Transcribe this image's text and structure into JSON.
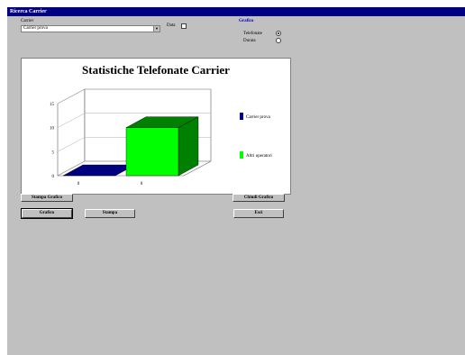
{
  "window": {
    "title": "Ricerca Carrier"
  },
  "form": {
    "carrier_label": "Carrier",
    "carrier_value": "Carrier prova",
    "data_label": "Data",
    "grafico_label": "Grafico",
    "radio_telefonate": "Telefonate",
    "radio_durata": "Durata",
    "radio_selected": "Telefonate"
  },
  "buttons": {
    "stampa_grafico": "Stampa Grafico",
    "chiudi_grafico": "Chiudi Grafico",
    "grafico": "Grafico",
    "stampa": "Stampa",
    "esci": "Esci"
  },
  "colors": {
    "window_bg": "#c0c0c0",
    "title_bar": "#000080",
    "series_1": "#000080",
    "series_2": "#00ff00",
    "series_2_dark": "#008000"
  },
  "chart_data": {
    "type": "bar",
    "title": "Statistiche Telefonate Carrier",
    "categories": [
      "0",
      "0"
    ],
    "yticks": [
      0,
      5,
      10,
      15
    ],
    "ylim": [
      0,
      15
    ],
    "series": [
      {
        "name": "Carrier prova",
        "values": [
          0
        ]
      },
      {
        "name": "Altri operatori",
        "values": [
          10
        ]
      }
    ],
    "legend_position": "right"
  }
}
